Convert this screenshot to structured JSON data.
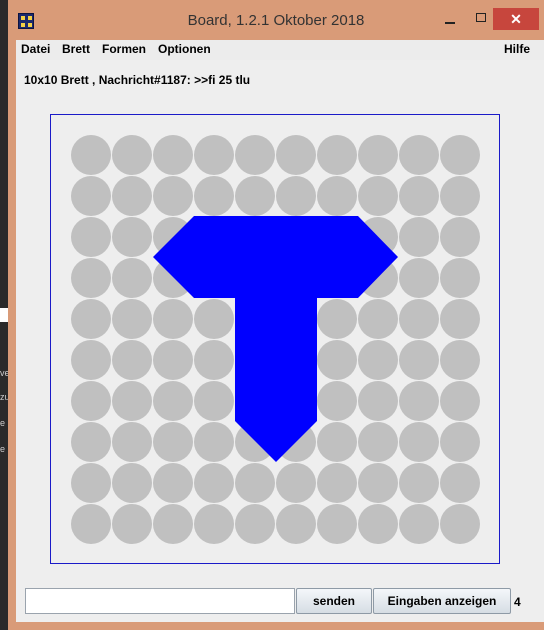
{
  "window": {
    "title": "Board, 1.2.1 Oktober 2018",
    "close_glyph": "✕"
  },
  "menu": {
    "items": [
      "Datei",
      "Brett",
      "Formen",
      "Optionen"
    ],
    "help": "Hilfe"
  },
  "status": {
    "info": "10x10 Brett , Nachricht#1187: >>fi 25 tlu"
  },
  "board": {
    "rows": 10,
    "cols": 10,
    "circle_color": "#c0c0c0",
    "frame_color": "#1a1ac8",
    "shape": {
      "name": "T",
      "color": "#0000ff"
    }
  },
  "controls": {
    "input_value": "",
    "send_label": "senden",
    "show_label": "Eingaben anzeigen",
    "count": "4"
  },
  "background_fragments": [
    "ve",
    "zu",
    "e",
    "e"
  ]
}
